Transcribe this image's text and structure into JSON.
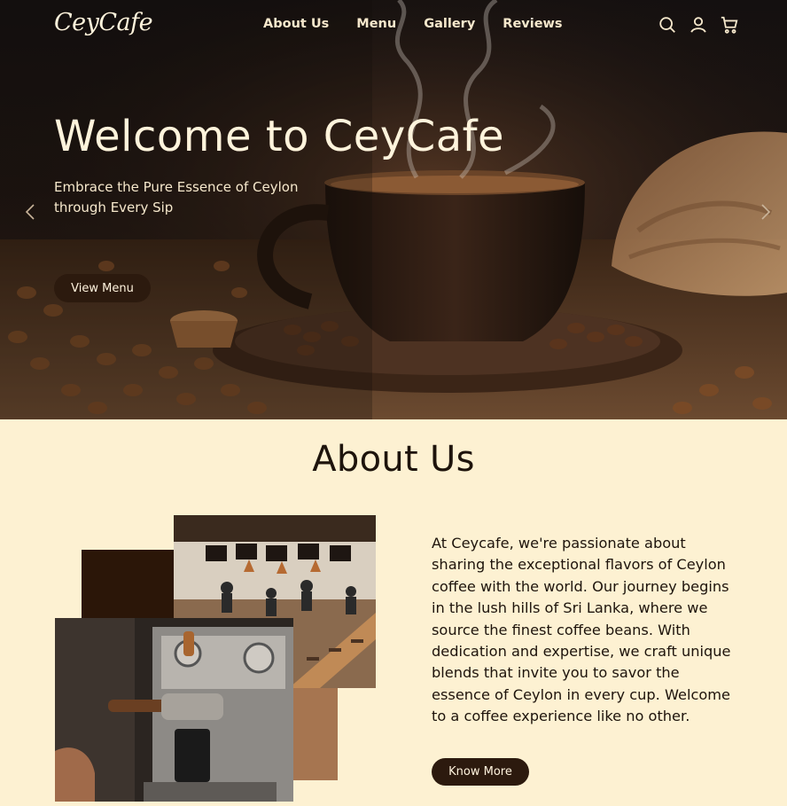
{
  "brand": {
    "logo": "CeyCafe"
  },
  "nav": {
    "links": [
      "About Us",
      "Menu",
      "Gallery",
      "Reviews"
    ],
    "icons": [
      "search-icon",
      "user-icon",
      "cart-icon"
    ]
  },
  "hero": {
    "title": "Welcome to CeyCafe",
    "subtitle": "Embrace the Pure Essence of Ceylon through Every Sip",
    "cta": "View Menu",
    "prev_icon": "chevron-left-icon",
    "next_icon": "chevron-right-icon"
  },
  "about": {
    "heading": "About Us",
    "body": "At Ceycafe, we're passionate about sharing the exceptional flavors of Ceylon coffee with the world. Our journey begins in the lush hills of Sri Lanka, where we source the finest coffee beans. With dedication and expertise, we craft unique blends that invite you to savor the essence of Ceylon in every cup. Welcome to a coffee experience like no other.",
    "cta": "Know More"
  },
  "colors": {
    "cream": "#fdf1d2",
    "dark_brown": "#2c1a0e",
    "tan": "#a67550",
    "text": "#1e140c"
  }
}
